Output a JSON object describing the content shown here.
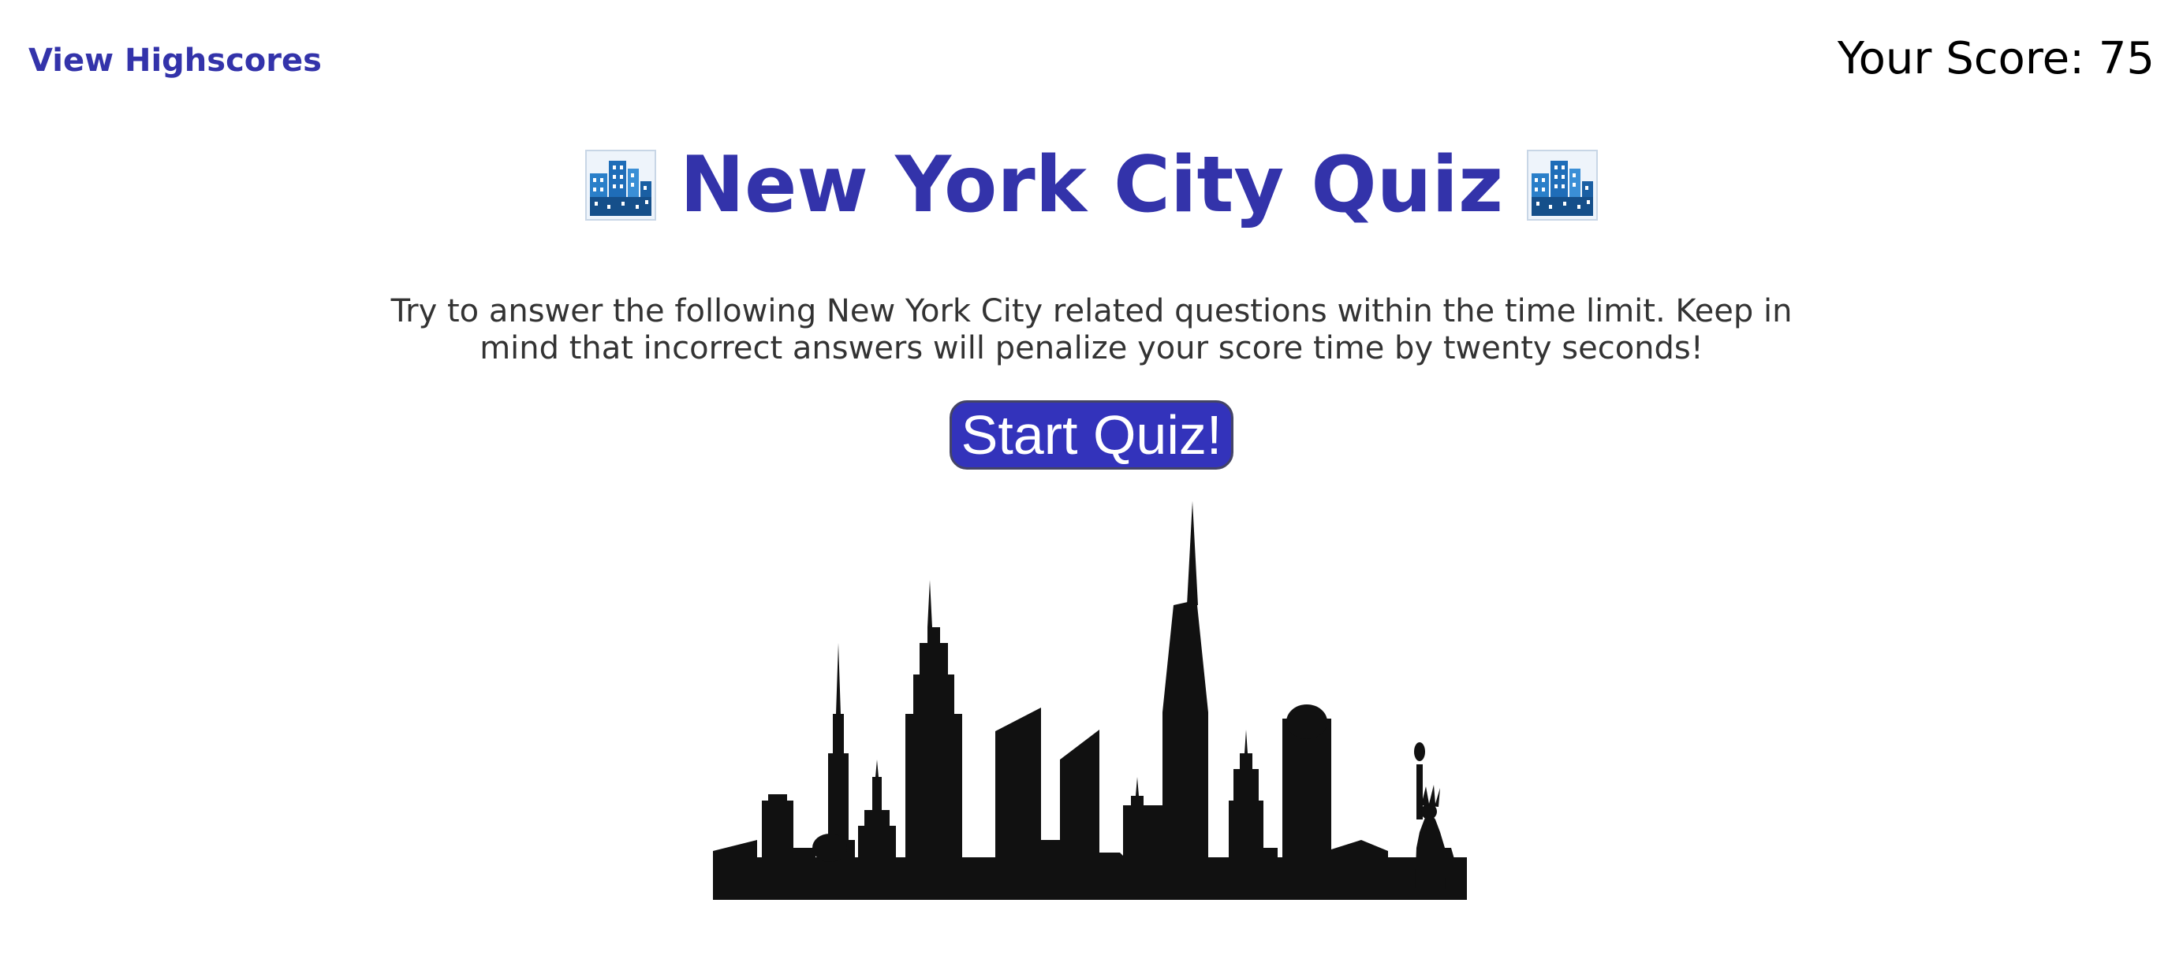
{
  "nav": {
    "highscores_label": "View Highscores"
  },
  "score": {
    "label": "Your Score: 75",
    "value": 75
  },
  "title": {
    "text": "New York City Quiz",
    "icon": "cityscape-icon"
  },
  "intro": {
    "text": "Try to answer the following New York City related questions within the time limit. Keep in mind that incorrect answers will penalize your score time by twenty seconds!"
  },
  "start_button": {
    "label": "Start Quiz!"
  },
  "colors": {
    "accent": "#3333aa",
    "button": "#3333bb",
    "skyline": "#111111"
  }
}
